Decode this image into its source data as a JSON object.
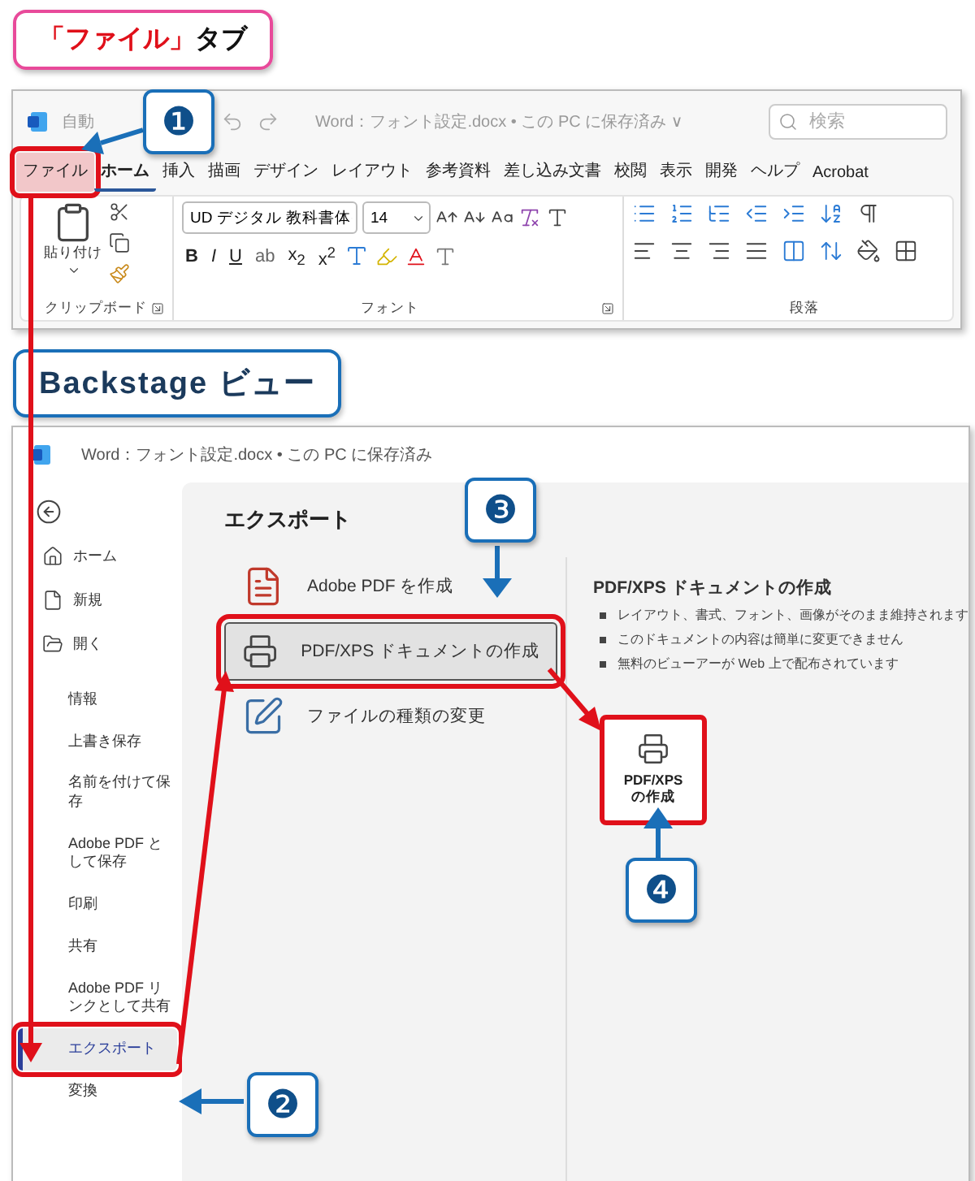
{
  "file_tab_label": {
    "parts": [
      {
        "text": "「ファイル」",
        "kind": "highlight"
      },
      {
        "text": "タブ",
        "kind": "plain"
      }
    ]
  },
  "word_window": {
    "autosave": "自動",
    "title": "Word：フォント設定.docx • この PC に保存済み ∨",
    "search": {
      "placeholder": "検索"
    },
    "tabs": [
      {
        "label": "ファイル",
        "selected": false,
        "highlighted": true
      },
      {
        "label": "ホーム",
        "selected": true,
        "highlighted": false
      },
      {
        "label": "挿入",
        "selected": false,
        "highlighted": false
      },
      {
        "label": "描画",
        "selected": false,
        "highlighted": false
      },
      {
        "label": "デザイン",
        "selected": false,
        "highlighted": false
      },
      {
        "label": "レイアウト",
        "selected": false,
        "highlighted": false
      },
      {
        "label": "参考資料",
        "selected": false,
        "highlighted": false
      },
      {
        "label": "差し込み文書",
        "selected": false,
        "highlighted": false
      },
      {
        "label": "校閲",
        "selected": false,
        "highlighted": false
      },
      {
        "label": "表示",
        "selected": false,
        "highlighted": false
      },
      {
        "label": "開発",
        "selected": false,
        "highlighted": false
      },
      {
        "label": "ヘルプ",
        "selected": false,
        "highlighted": false
      },
      {
        "label": "Acrobat",
        "selected": false,
        "highlighted": false
      }
    ],
    "clipboard": {
      "paste": "貼り付け",
      "label": "クリップボード"
    },
    "font": {
      "font_name": "UD デジタル 教科書体",
      "font_size": "14",
      "format_buttons": [
        "B",
        "I",
        "U",
        "ab",
        "x$_{2}$",
        "x$^{2}$"
      ],
      "label": "フォント"
    },
    "paragraph": {
      "label": "段落"
    }
  },
  "backstage_label": "Backstage ビュー",
  "backstage": {
    "title": "Word：フォント設定.docx • この PC に保存済み",
    "sidebar": [
      {
        "label": "ホーム",
        "kind": "home",
        "selected": false,
        "highlighted": false
      },
      {
        "label": "新規",
        "kind": "new",
        "selected": false,
        "highlighted": false
      },
      {
        "label": "開く",
        "kind": "open",
        "selected": false,
        "highlighted": false
      },
      {
        "label": "情報",
        "kind": "plain",
        "selected": false,
        "highlighted": false
      },
      {
        "label": "上書き保存",
        "kind": "plain",
        "selected": false,
        "highlighted": false
      },
      {
        "label": "名前を付けて保存",
        "kind": "plain",
        "selected": false,
        "highlighted": false
      },
      {
        "label": "Adobe PDF として保存",
        "kind": "plain",
        "selected": false,
        "highlighted": false
      },
      {
        "label": "印刷",
        "kind": "plain",
        "selected": false,
        "highlighted": false
      },
      {
        "label": "共有",
        "kind": "plain",
        "selected": false,
        "highlighted": false
      },
      {
        "label": "Adobe PDF リンクとして共有",
        "kind": "plain",
        "selected": false,
        "highlighted": false
      },
      {
        "label": "エクスポート",
        "kind": "plain",
        "selected": true,
        "highlighted": true
      },
      {
        "label": "変換",
        "kind": "plain",
        "selected": false,
        "highlighted": false
      }
    ],
    "heading": "エクスポート",
    "options": [
      {
        "label": "Adobe PDF を作成",
        "kind": "adobe",
        "selected": false,
        "highlighted": false
      },
      {
        "label": "PDF/XPS ドキュメントの作成",
        "kind": "pdf",
        "selected": true,
        "highlighted": true
      },
      {
        "label": "ファイルの種類の変更",
        "kind": "change",
        "selected": false,
        "highlighted": false
      }
    ],
    "detail": {
      "heading": "PDF/XPS ドキュメントの作成",
      "bullets": [
        "レイアウト、書式、フォント、画像がそのまま維持されます",
        "このドキュメントの内容は簡単に変更できません",
        "無料のビューアーが Web 上で配布されています"
      ],
      "button": {
        "label": "PDF/XPS\nの作成",
        "highlighted": true
      }
    }
  },
  "callouts": [
    "❶",
    "❷",
    "❸",
    "❹"
  ]
}
